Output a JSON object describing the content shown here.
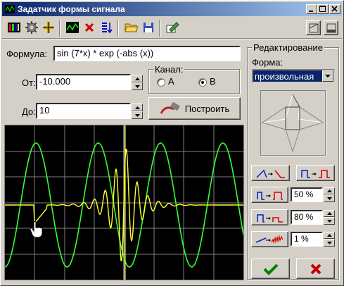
{
  "window": {
    "title": "Задатчик формы сигнала"
  },
  "form": {
    "formula_label": "Формула:",
    "formula_value": "sin (7*x) * exp (-abs (x))",
    "from_label": "От:",
    "from_value": "-10.000",
    "to_label": "До:",
    "to_value": "10",
    "channel_label": "Канал:",
    "channel_a": "A",
    "channel_b": "B",
    "channel_selected": "B",
    "build_button": "Построить"
  },
  "editing": {
    "group_label": "Редактирование",
    "shape_label": "Форма:",
    "shape_value": "произвольная",
    "percent1": "50 %",
    "percent2": "80 %",
    "percent3": "1 %"
  },
  "icons": {
    "toolbar": [
      "color-bars-icon",
      "gear-icon",
      "crosshair-icon",
      "graph-icon",
      "delete-icon",
      "sort-icon",
      "open-folder-icon",
      "save-icon",
      "edit-icon"
    ],
    "dialog_ok": "check-icon",
    "dialog_cancel": "x-icon"
  },
  "colors": {
    "title_start": "#0a246a",
    "title_end": "#a6caf0",
    "plot_background": "#000000",
    "grid": "#808080",
    "trace_green": "#33ff33",
    "trace_yellow": "#ffff33"
  }
}
